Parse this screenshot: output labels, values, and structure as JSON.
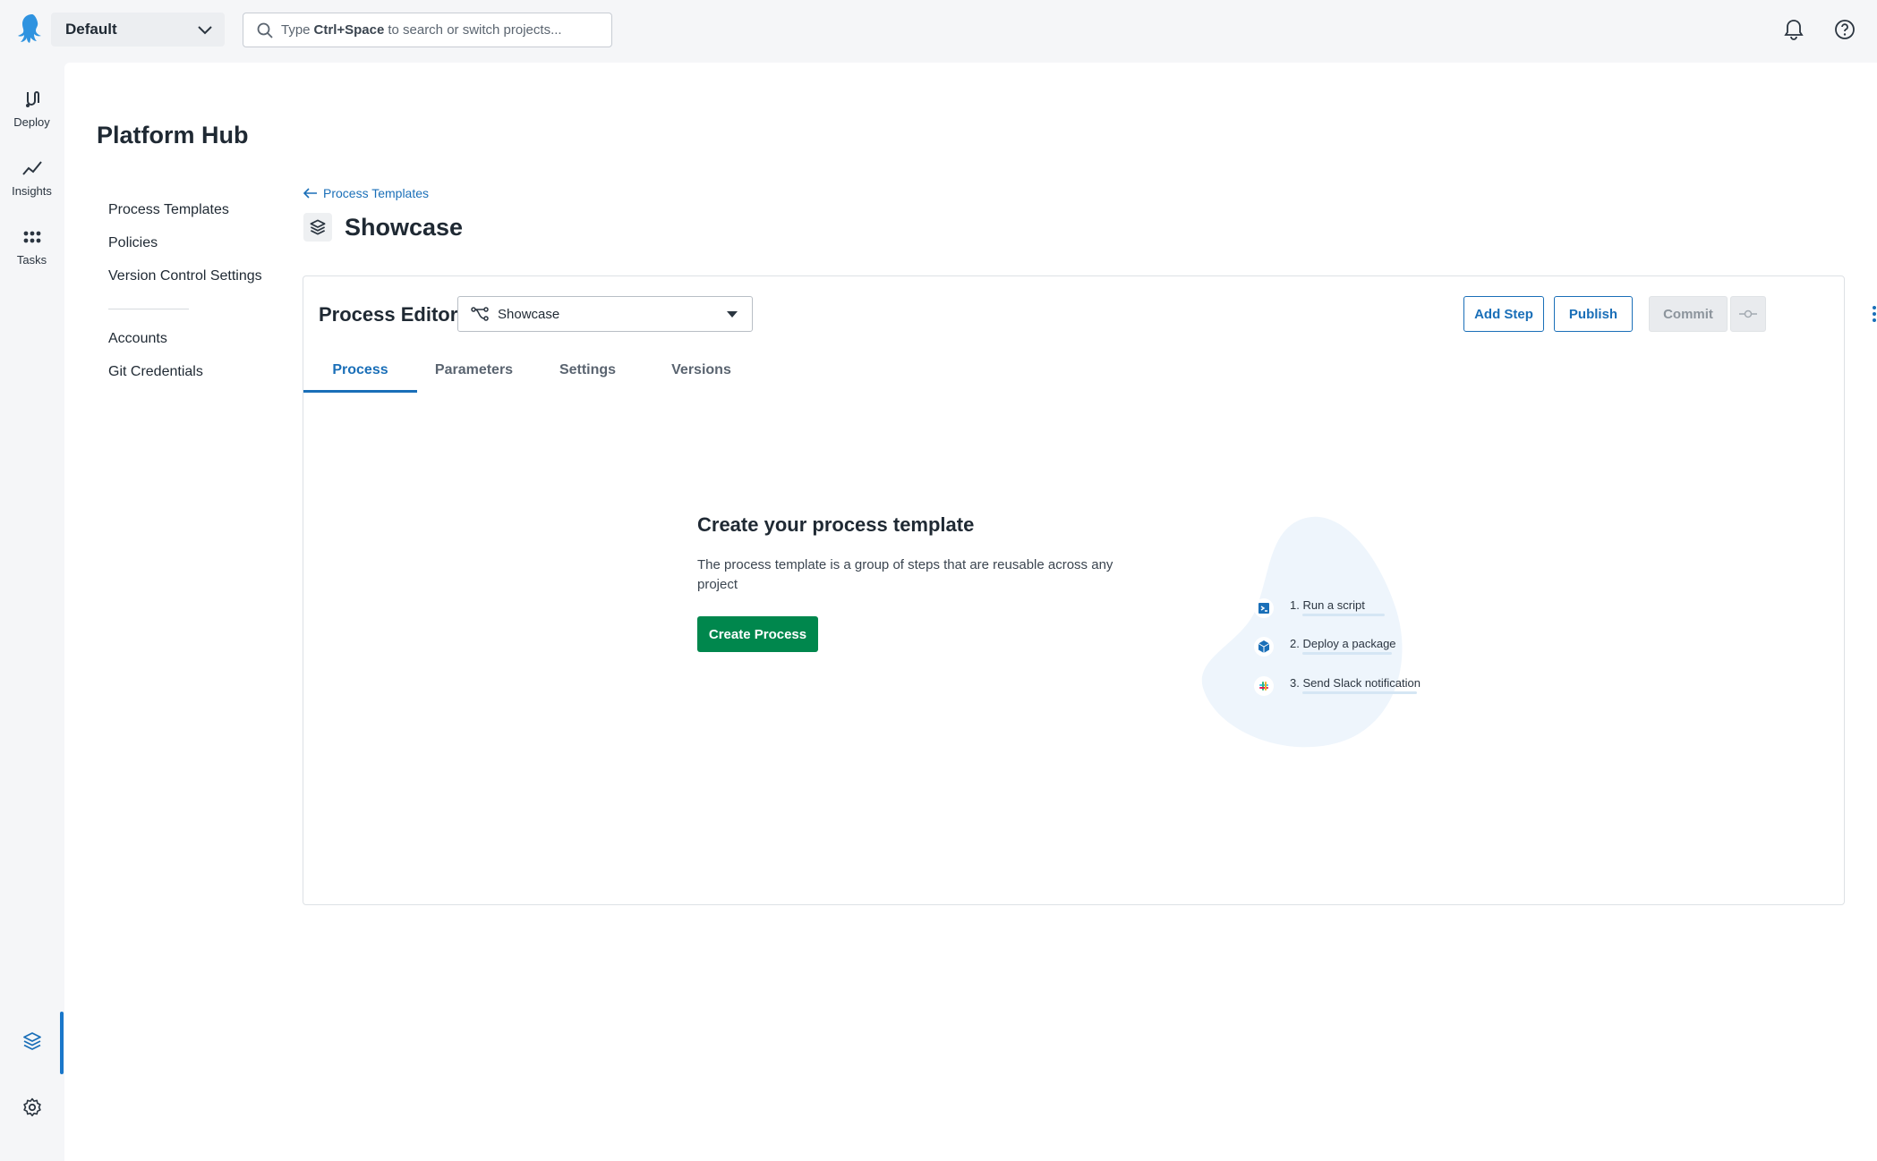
{
  "topbar": {
    "space_name": "Default",
    "search_placeholder_prefix": "Type",
    "search_shortcut": "Ctrl+Space",
    "search_placeholder_suffix": "to search or switch projects..."
  },
  "rail": {
    "items": [
      {
        "label": "Deploy",
        "icon": "deploy-icon"
      },
      {
        "label": "Insights",
        "icon": "insights-icon"
      },
      {
        "label": "Tasks",
        "icon": "tasks-icon"
      }
    ],
    "bottom_icons": [
      "platform-hub-icon",
      "settings-icon",
      "octopus-logo-icon"
    ]
  },
  "page": {
    "title": "Platform Hub"
  },
  "subnav": {
    "group1": [
      "Process Templates",
      "Policies",
      "Version Control Settings"
    ],
    "group2": [
      "Accounts",
      "Git Credentials"
    ]
  },
  "breadcrumb": {
    "back_label": "Process Templates"
  },
  "project": {
    "title": "Showcase"
  },
  "editor": {
    "title": "Process Editor",
    "selected_process": "Showcase",
    "buttons": {
      "add_step": "Add Step",
      "publish": "Publish",
      "commit": "Commit"
    },
    "tabs": [
      "Process",
      "Parameters",
      "Settings",
      "Versions"
    ],
    "active_tab": "Process"
  },
  "empty_state": {
    "title": "Create your process template",
    "description": "The process template is a group of steps that are reusable across any project",
    "button": "Create Process",
    "steps": [
      "1. Run a script",
      "2. Deploy a package",
      "3. Send Slack notification"
    ]
  },
  "colors": {
    "accent": "#1a6fb8",
    "create_button": "#00874d",
    "brand": "#2f93e0"
  }
}
